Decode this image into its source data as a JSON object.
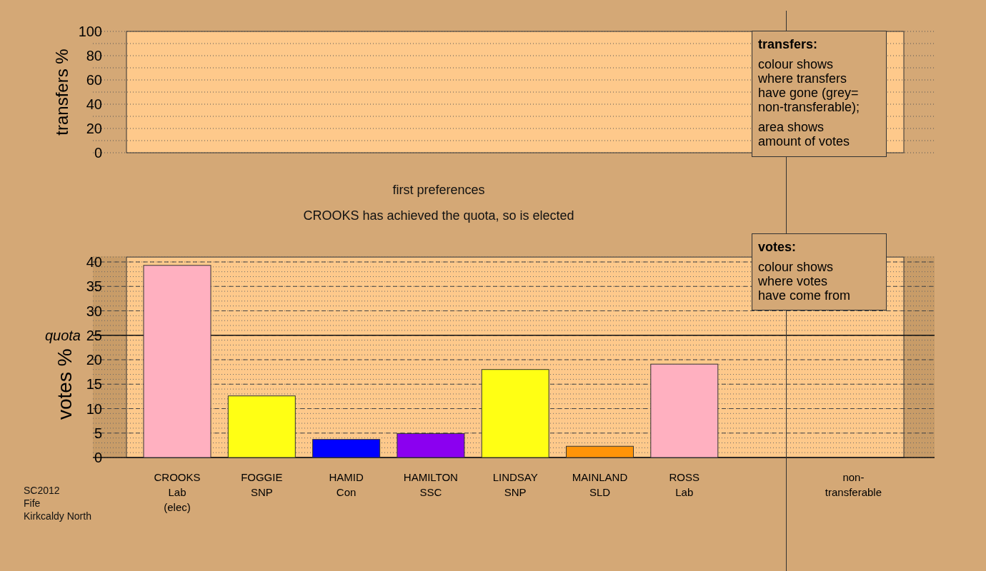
{
  "top_chart": {
    "chart_data": {
      "type": "bar",
      "ylabel": "transfers %",
      "categories": [
        null,
        null,
        null,
        null,
        null,
        null,
        null,
        null,
        null
      ],
      "series": [
        {
          "values": [
            null,
            null,
            null,
            null,
            null,
            null,
            null,
            null,
            null
          ]
        }
      ],
      "ylim": [
        0,
        100
      ],
      "yticks": [
        0,
        20,
        40,
        60,
        80,
        100
      ],
      "grid": true
    },
    "legend": {
      "title": "transfers:",
      "paragraphs": [
        [
          "colour shows",
          "where transfers",
          "have gone (grey=",
          "non-transferable);"
        ],
        [
          "area shows",
          "amount of votes"
        ]
      ]
    }
  },
  "headings": [
    "first preferences",
    "CROOKS has achieved the quota, so is elected"
  ],
  "bottom_chart": {
    "chart_data": {
      "type": "bar",
      "ylabel": "votes %",
      "categories": [
        "CROOKS\nLab\n(elec)",
        "FOGGIE\nSNP",
        "HAMID\nCon",
        "HAMILTON\nSSC",
        "LINDSAY\nSNP",
        "MAINLAND\nSLD",
        "ROSS\nLab",
        null,
        "non-\ntransferable"
      ],
      "series": [
        {
          "values": [
            39.3,
            12.6,
            3.7,
            4.9,
            18.0,
            2.3,
            19.1,
            null,
            null
          ],
          "colors": [
            "#ffb0c0",
            "#ffff14",
            "#0000ff",
            "#8b00f0",
            "#ffff14",
            "#ff9408",
            "#ffb0c0",
            null,
            null
          ]
        }
      ],
      "ylim": [
        0,
        41
      ],
      "yticks": [
        0,
        5,
        10,
        15,
        20,
        25,
        30,
        35,
        40
      ],
      "grid": true,
      "ref_lines": [
        {
          "axis": "y",
          "value": 25,
          "label": "quota"
        }
      ]
    },
    "legend": {
      "title": "votes:",
      "paragraphs": [
        [
          "colour shows",
          "where votes",
          "have come from"
        ]
      ]
    }
  },
  "footer": [
    "SC2012",
    "Fife",
    "Kirkcaldy North"
  ]
}
